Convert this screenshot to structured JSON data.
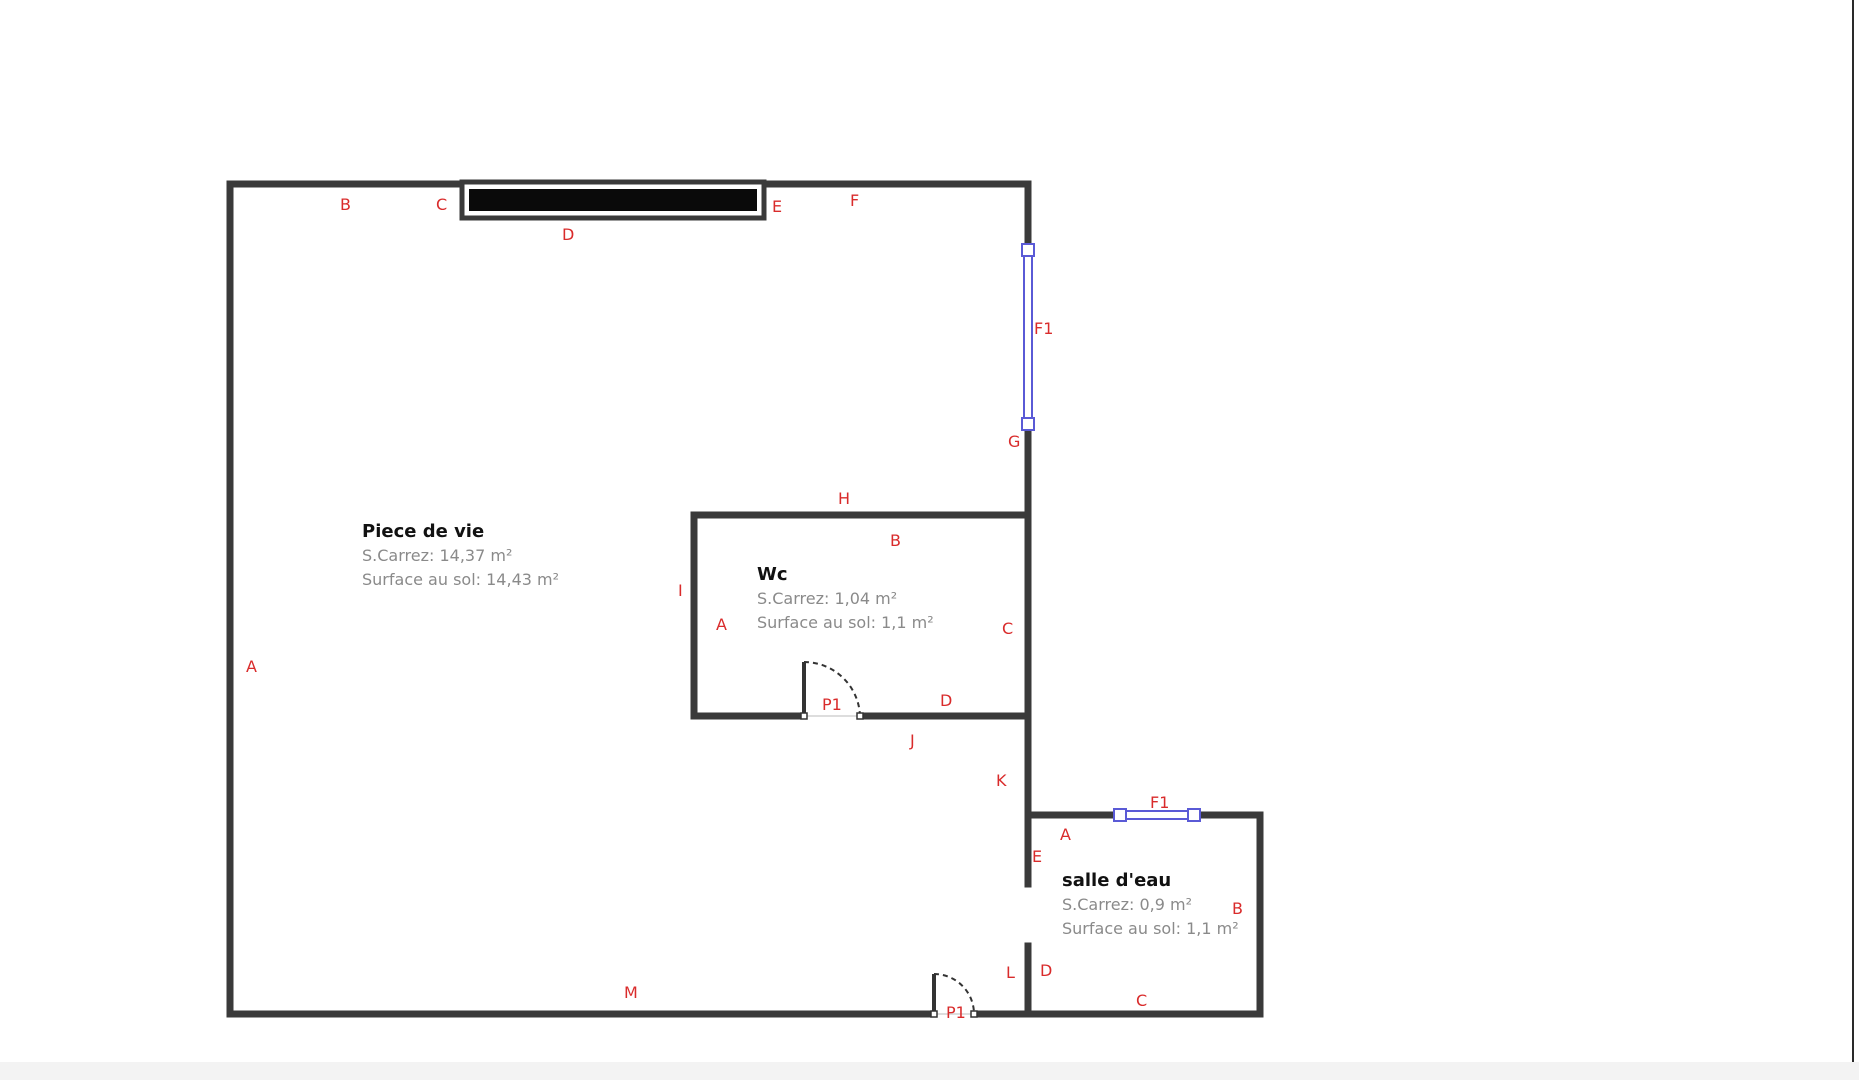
{
  "rooms": {
    "piece_de_vie": {
      "name": "Piece de vie",
      "carrez": "S.Carrez: 14,37 m²",
      "sol": "Surface au sol: 14,43 m²",
      "walls": {
        "a": "A",
        "b": "B",
        "c": "C",
        "d": "D",
        "e": "E",
        "f": "F",
        "g": "G",
        "h": "H",
        "i": "I",
        "j": "J",
        "k": "K",
        "l": "L",
        "m": "M"
      },
      "window": "F1",
      "door": "P1"
    },
    "wc": {
      "name": "Wc",
      "carrez": "S.Carrez: 1,04 m²",
      "sol": "Surface au sol: 1,1 m²",
      "walls": {
        "a": "A",
        "b": "B",
        "c": "C",
        "d": "D"
      },
      "door": "P1"
    },
    "salle_d_eau": {
      "name": "salle d'eau",
      "carrez": "S.Carrez: 0,9 m²",
      "sol": "Surface au sol: 1,1 m²",
      "walls": {
        "a": "A",
        "b": "B",
        "c": "C",
        "d": "D",
        "e": "E"
      },
      "window": "F1"
    }
  },
  "colors": {
    "wall": "#3a3a3a",
    "label": "#d92b2b",
    "window": "#5a5ad6",
    "info_text": "#8a8a8a"
  }
}
